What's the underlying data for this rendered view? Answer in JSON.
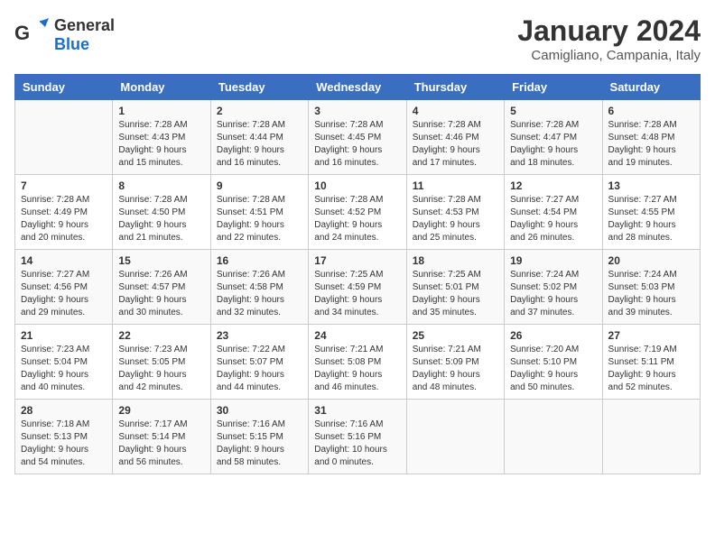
{
  "header": {
    "logo": {
      "general": "General",
      "blue": "Blue"
    },
    "title": "January 2024",
    "location": "Camigliano, Campania, Italy"
  },
  "days_of_week": [
    "Sunday",
    "Monday",
    "Tuesday",
    "Wednesday",
    "Thursday",
    "Friday",
    "Saturday"
  ],
  "weeks": [
    [
      {
        "day": "",
        "info": ""
      },
      {
        "day": "1",
        "info": "Sunrise: 7:28 AM\nSunset: 4:43 PM\nDaylight: 9 hours\nand 15 minutes."
      },
      {
        "day": "2",
        "info": "Sunrise: 7:28 AM\nSunset: 4:44 PM\nDaylight: 9 hours\nand 16 minutes."
      },
      {
        "day": "3",
        "info": "Sunrise: 7:28 AM\nSunset: 4:45 PM\nDaylight: 9 hours\nand 16 minutes."
      },
      {
        "day": "4",
        "info": "Sunrise: 7:28 AM\nSunset: 4:46 PM\nDaylight: 9 hours\nand 17 minutes."
      },
      {
        "day": "5",
        "info": "Sunrise: 7:28 AM\nSunset: 4:47 PM\nDaylight: 9 hours\nand 18 minutes."
      },
      {
        "day": "6",
        "info": "Sunrise: 7:28 AM\nSunset: 4:48 PM\nDaylight: 9 hours\nand 19 minutes."
      }
    ],
    [
      {
        "day": "7",
        "info": "Sunrise: 7:28 AM\nSunset: 4:49 PM\nDaylight: 9 hours\nand 20 minutes."
      },
      {
        "day": "8",
        "info": "Sunrise: 7:28 AM\nSunset: 4:50 PM\nDaylight: 9 hours\nand 21 minutes."
      },
      {
        "day": "9",
        "info": "Sunrise: 7:28 AM\nSunset: 4:51 PM\nDaylight: 9 hours\nand 22 minutes."
      },
      {
        "day": "10",
        "info": "Sunrise: 7:28 AM\nSunset: 4:52 PM\nDaylight: 9 hours\nand 24 minutes."
      },
      {
        "day": "11",
        "info": "Sunrise: 7:28 AM\nSunset: 4:53 PM\nDaylight: 9 hours\nand 25 minutes."
      },
      {
        "day": "12",
        "info": "Sunrise: 7:27 AM\nSunset: 4:54 PM\nDaylight: 9 hours\nand 26 minutes."
      },
      {
        "day": "13",
        "info": "Sunrise: 7:27 AM\nSunset: 4:55 PM\nDaylight: 9 hours\nand 28 minutes."
      }
    ],
    [
      {
        "day": "14",
        "info": "Sunrise: 7:27 AM\nSunset: 4:56 PM\nDaylight: 9 hours\nand 29 minutes."
      },
      {
        "day": "15",
        "info": "Sunrise: 7:26 AM\nSunset: 4:57 PM\nDaylight: 9 hours\nand 30 minutes."
      },
      {
        "day": "16",
        "info": "Sunrise: 7:26 AM\nSunset: 4:58 PM\nDaylight: 9 hours\nand 32 minutes."
      },
      {
        "day": "17",
        "info": "Sunrise: 7:25 AM\nSunset: 4:59 PM\nDaylight: 9 hours\nand 34 minutes."
      },
      {
        "day": "18",
        "info": "Sunrise: 7:25 AM\nSunset: 5:01 PM\nDaylight: 9 hours\nand 35 minutes."
      },
      {
        "day": "19",
        "info": "Sunrise: 7:24 AM\nSunset: 5:02 PM\nDaylight: 9 hours\nand 37 minutes."
      },
      {
        "day": "20",
        "info": "Sunrise: 7:24 AM\nSunset: 5:03 PM\nDaylight: 9 hours\nand 39 minutes."
      }
    ],
    [
      {
        "day": "21",
        "info": "Sunrise: 7:23 AM\nSunset: 5:04 PM\nDaylight: 9 hours\nand 40 minutes."
      },
      {
        "day": "22",
        "info": "Sunrise: 7:23 AM\nSunset: 5:05 PM\nDaylight: 9 hours\nand 42 minutes."
      },
      {
        "day": "23",
        "info": "Sunrise: 7:22 AM\nSunset: 5:07 PM\nDaylight: 9 hours\nand 44 minutes."
      },
      {
        "day": "24",
        "info": "Sunrise: 7:21 AM\nSunset: 5:08 PM\nDaylight: 9 hours\nand 46 minutes."
      },
      {
        "day": "25",
        "info": "Sunrise: 7:21 AM\nSunset: 5:09 PM\nDaylight: 9 hours\nand 48 minutes."
      },
      {
        "day": "26",
        "info": "Sunrise: 7:20 AM\nSunset: 5:10 PM\nDaylight: 9 hours\nand 50 minutes."
      },
      {
        "day": "27",
        "info": "Sunrise: 7:19 AM\nSunset: 5:11 PM\nDaylight: 9 hours\nand 52 minutes."
      }
    ],
    [
      {
        "day": "28",
        "info": "Sunrise: 7:18 AM\nSunset: 5:13 PM\nDaylight: 9 hours\nand 54 minutes."
      },
      {
        "day": "29",
        "info": "Sunrise: 7:17 AM\nSunset: 5:14 PM\nDaylight: 9 hours\nand 56 minutes."
      },
      {
        "day": "30",
        "info": "Sunrise: 7:16 AM\nSunset: 5:15 PM\nDaylight: 9 hours\nand 58 minutes."
      },
      {
        "day": "31",
        "info": "Sunrise: 7:16 AM\nSunset: 5:16 PM\nDaylight: 10 hours\nand 0 minutes."
      },
      {
        "day": "",
        "info": ""
      },
      {
        "day": "",
        "info": ""
      },
      {
        "day": "",
        "info": ""
      }
    ]
  ]
}
